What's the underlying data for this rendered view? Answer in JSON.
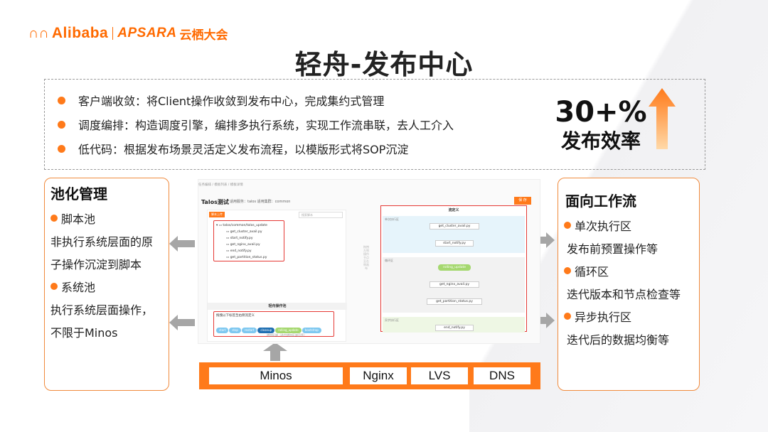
{
  "brand": {
    "alibaba": "Alibaba",
    "apsara": "APSARA",
    "event": "云栖大会",
    "accent_color": "#ff7a1a"
  },
  "title": "轻舟-发布中心",
  "summary_bullets": [
    "客户端收敛：将Client操作收敛到发布中心，完成集约式管理",
    "调度编排：构造调度引擎，编排多执行系统，实现工作流串联，去人工介入",
    "低代码：根据发布场景灵活定义发布流程，以模版形式将SOP沉淀"
  ],
  "metric": {
    "value": "30+%",
    "label": "发布效率",
    "icon": "up-arrow-icon"
  },
  "pool_management": {
    "title": "池化管理",
    "script_pool": "脚本池",
    "script_desc_1": "非执行系统层面的原",
    "script_desc_2": "子操作沉淀到脚本",
    "system_pool": "系统池",
    "system_desc_1": "执行系统层面操作，",
    "system_desc_2": "不限于Minos"
  },
  "workflow": {
    "title": "面向工作流",
    "single_zone": "单次执行区",
    "single_desc": "发布前预置操作等",
    "loop_zone": "循环区",
    "loop_desc": "迭代版本和节点检查等",
    "async_zone": "异步执行区",
    "async_desc": "迭代后的数据均衡等"
  },
  "screenshot": {
    "breadcrumb": "任务编排  /  模板列表  /  模板详情",
    "page_title": "Talos测试",
    "subtitle": "适用服务：talos   适用集群：common",
    "save_button": "保 存",
    "script_tag": "脚本上传",
    "search_placeholder": "搜索脚本",
    "folder": "talos/common/talos_update",
    "files": [
      "get_cluster_avail.py",
      "start_notify.py",
      "get_nginx_avail.py",
      "end_notify.py",
      "get_partition_status.py"
    ],
    "pool_title": "轻舟操作池",
    "pool_hint": "拖拽以下标签至右侧流定义",
    "pool_chips": [
      "start",
      "stop",
      "restart",
      "cleanup",
      "rolling_update",
      "bootstrap"
    ],
    "vertical_hint": "拖拽左侧操作节点至右侧画布",
    "flow_title": "流定义",
    "zone_single": "单次执行区",
    "zone_loop": "循环区",
    "zone_async": "异步执行区",
    "nodes": {
      "get_cluster_avail": "get_cluster_avail.py",
      "start_notify": "start_notify.py",
      "rolling_update": "rolling_update",
      "get_nginx_avail": "get_nginx_avail.py",
      "get_partition_status": "get_partition_status.py",
      "end_notify": "end_notify.py"
    },
    "footer": "增加区域（选中增加区域页签）"
  },
  "systems": [
    "Minos",
    "Nginx",
    "LVS",
    "DNS"
  ]
}
